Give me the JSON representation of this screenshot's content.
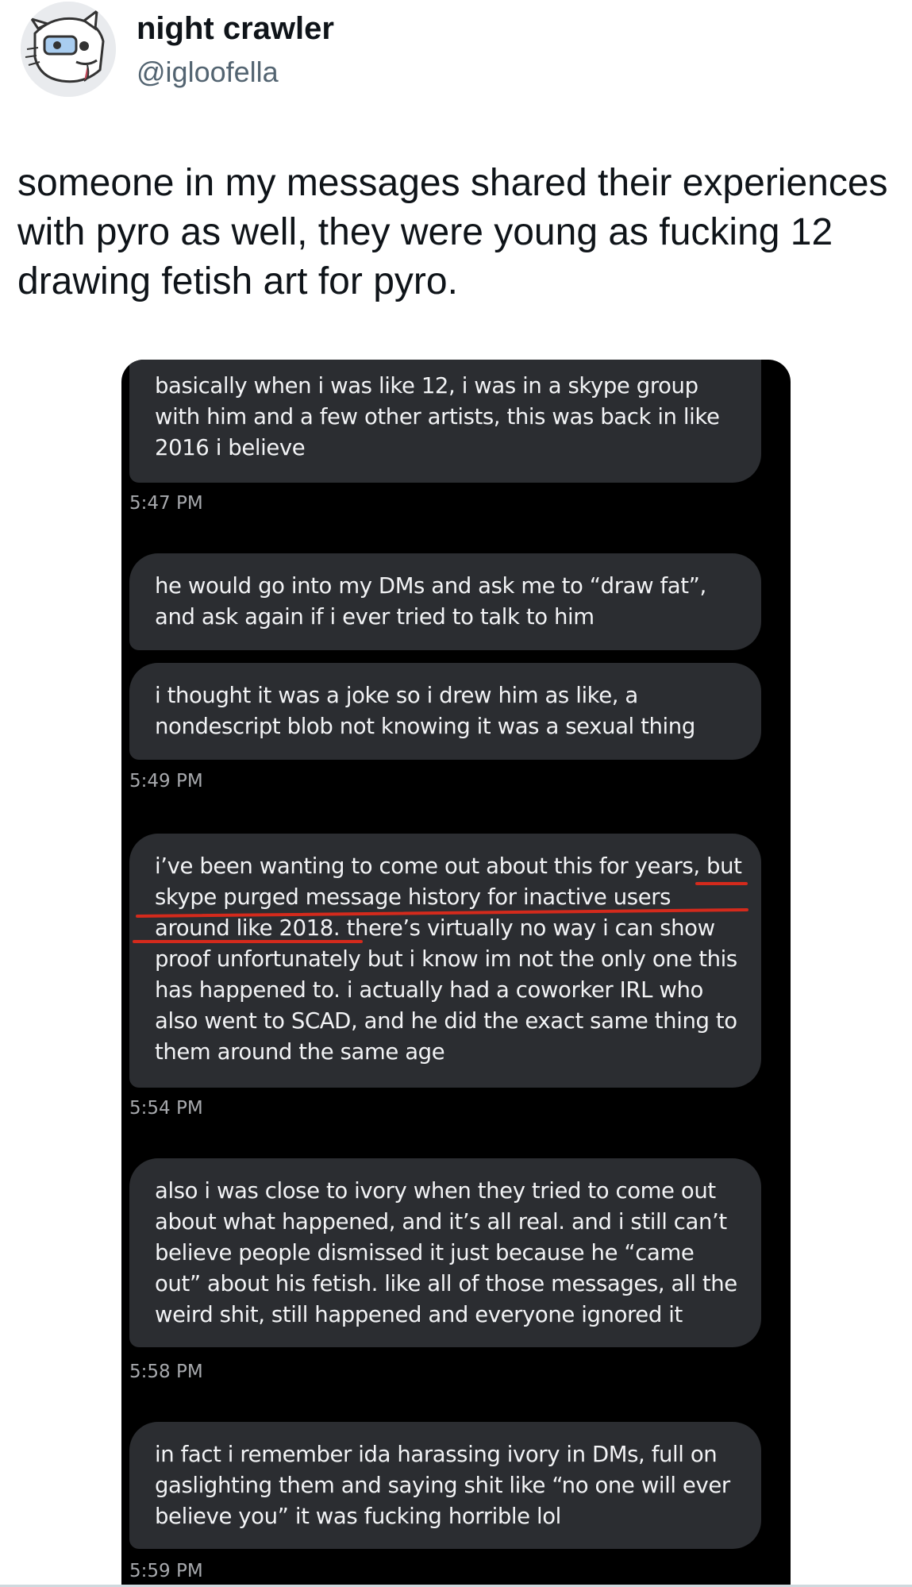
{
  "author": {
    "name": "night crawler",
    "handle": "@igloofella",
    "avatar_icon": "cartoon-animal-avatar-icon"
  },
  "tweet": {
    "lines": [
      "someone in my messages shared their experiences",
      "with pyro as well, they were young as fucking 12",
      "drawing fetish art for pyro."
    ]
  },
  "screenshot": {
    "bubbles": [
      {
        "lines": [
          "basically when i was like 12, i was in a skype group",
          "with him and a few other artists, this was back in like",
          "2016 i believe"
        ]
      },
      {
        "lines": [
          "he would go into my DMs and ask me to “draw fat”,",
          "and ask again if i ever tried to talk to him"
        ]
      },
      {
        "lines": [
          "i thought it was a joke so i drew him as like, a",
          "nondescript blob not knowing it was a sexual thing"
        ]
      },
      {
        "lines": [
          "i’ve been wanting to come out about this for years, but",
          "skype purged message history for inactive users",
          "around like 2018. there’s virtually no way i can show",
          "proof unfortunately but i know im not the only one this",
          "has happened to. i actually had a coworker IRL who",
          "also went to SCAD, and he did the exact same thing to",
          "them around the same age"
        ]
      },
      {
        "lines": [
          "also i was close to ivory when they tried to come out",
          "about what happened, and it’s all real. and i still can’t",
          "believe people dismissed it just because he “came",
          "out” about his fetish. like all of those messages, all the",
          "weird shit, still happened and everyone ignored it"
        ]
      },
      {
        "lines": [
          "in fact i remember ida harassing ivory in DMs, full on",
          "gaslighting them and saying shit like “no one will ever",
          "believe you” it was fucking horrible lol"
        ]
      }
    ],
    "timestamps": [
      "5:47 PM",
      "5:49 PM",
      "5:54 PM",
      "5:58 PM",
      "5:59 PM"
    ],
    "annotation_color": "#d42a1c"
  }
}
